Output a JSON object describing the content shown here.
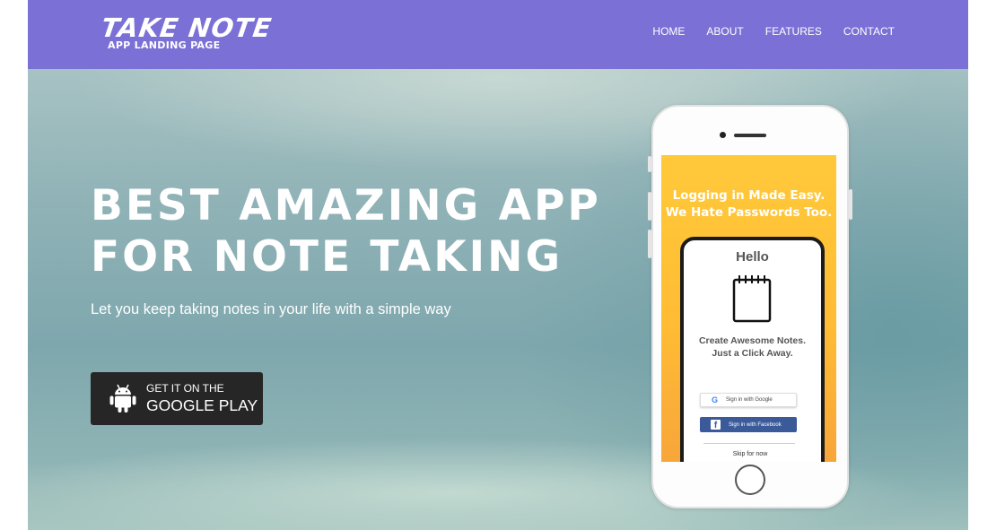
{
  "brand": {
    "logo_title": "TAKE NOTE",
    "logo_subtitle": "APP LANDING PAGE",
    "nav_color": "#7b70d6"
  },
  "nav": {
    "items": [
      {
        "label": "HOME"
      },
      {
        "label": "ABOUT"
      },
      {
        "label": "FEATURES"
      },
      {
        "label": "CONTACT"
      }
    ]
  },
  "hero": {
    "headline_line1": "BEST AMAZING APP",
    "headline_line2": "FOR NOTE TAKING",
    "subtext": "Let you keep taking notes in your life with a simple way",
    "store_button": {
      "small_text": "GET IT ON THE",
      "big_text": "GOOGLE PLAY",
      "icon": "android-icon",
      "color": "#262626"
    }
  },
  "phone_screen": {
    "title_line1": "Logging in Made Easy.",
    "title_line2": "We Hate Passwords Too.",
    "hello": "Hello",
    "desc_line1": "Create Awesome Notes.",
    "desc_line2": "Just a Click Away.",
    "google_button": "Sign in with Google",
    "facebook_button": "Sign in with Facebook",
    "skip": "Skip for now",
    "accent_color": "#ffc93a",
    "facebook_color": "#3b5a9a"
  }
}
